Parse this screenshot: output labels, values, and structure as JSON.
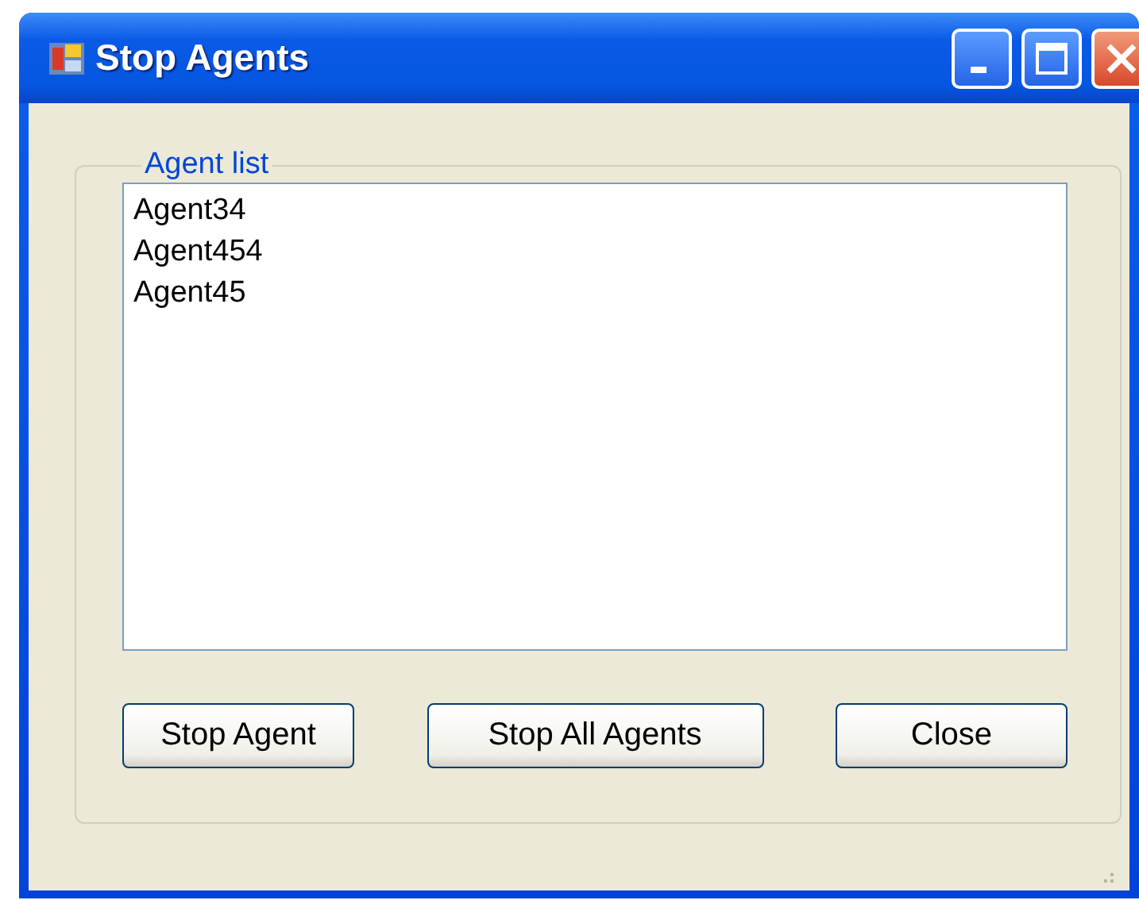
{
  "window": {
    "title": "Stop Agents"
  },
  "group": {
    "label": "Agent list"
  },
  "list": {
    "items": [
      "Agent34",
      "Agent454",
      "Agent45"
    ]
  },
  "buttons": [
    "Stop Agent",
    "Stop All Agents",
    "Close"
  ]
}
